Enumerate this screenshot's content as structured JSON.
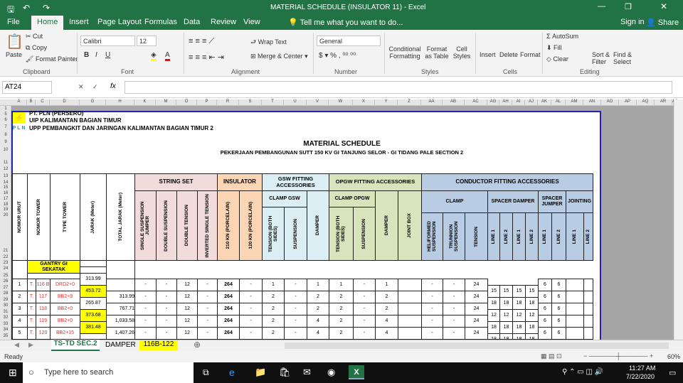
{
  "window": {
    "title": "MATERIAL SCHEDULE (INSULATOR 11)  -  Excel",
    "sign_in": "Sign in",
    "share": "Share"
  },
  "ribbon_tabs": [
    "File",
    "Home",
    "Insert",
    "Page Layout",
    "Formulas",
    "Data",
    "Review",
    "View"
  ],
  "tell_me": "Tell me what you want to do...",
  "clipboard": {
    "paste": "Paste",
    "cut": "Cut",
    "copy": "Copy",
    "format_painter": "Format Painter",
    "group": "Clipboard"
  },
  "font": {
    "name": "Calibri",
    "size": "12",
    "group": "Font"
  },
  "alignment": {
    "wrap": "Wrap Text",
    "merge": "Merge & Center",
    "group": "Alignment"
  },
  "number": {
    "format": "General",
    "group": "Number"
  },
  "styles": {
    "cond": "Conditional Formatting",
    "table": "Format as Table",
    "cell": "Cell Styles",
    "group": "Styles"
  },
  "cells": {
    "insert": "Insert",
    "delete": "Delete",
    "format": "Format",
    "group": "Cells"
  },
  "editing": {
    "autosum": "AutoSum",
    "fill": "Fill",
    "clear": "Clear",
    "sort": "Sort & Filter",
    "find": "Find & Select",
    "group": "Editing"
  },
  "formula_bar": {
    "name_box": "AT24",
    "fx": "fx",
    "value": ""
  },
  "columns": [
    "A",
    "B",
    "C",
    "D",
    "G",
    "H",
    "K",
    "M",
    "O",
    "P",
    "R",
    "S",
    "T",
    "U",
    "V",
    "W",
    "X",
    "Y",
    "Z",
    "AA",
    "AB",
    "AC",
    "AG",
    "AH",
    "AI",
    "AJ",
    "AK",
    "AL",
    "AM",
    "AN",
    "AO",
    "AP",
    "AQ",
    "AR",
    "AS"
  ],
  "rows": [
    "1",
    "5",
    "6",
    "7",
    "8",
    "9",
    "10",
    "11",
    "12",
    "13",
    "14",
    "15",
    "16",
    "17",
    "18",
    "19",
    "20",
    "21",
    "22",
    "23",
    "24",
    "25",
    "26",
    "27",
    "28",
    "29",
    "30",
    "31",
    "32",
    "33",
    "34",
    "35"
  ],
  "company": {
    "logo_text": "PLN",
    "line1": "PT. PLN (PERSERO)",
    "line2": "UIP KALIMANTAN BAGIAN TIMUR",
    "line3": "UPP PEMBANGKIT DAN JARINGAN KALIMANTAN BAGIAN TIMUR 2"
  },
  "doc": {
    "title": "MATERIAL  SCHEDULE",
    "subtitle": "PEKERJAAN PEMBANGUNAN SUTT 150 KV GI TANJUNG SELOR - GI TIDANG PALE SECTION 2"
  },
  "headers": {
    "nomor_urut": "NOMOR URUT",
    "nomor_tower": "NOMOR TOWER",
    "type_tower": "TYPE  TOWER",
    "jarak": "JARAK (Meter)",
    "total_jarak": "TOTAL JARAK (Meter)",
    "string_set": "STRING SET",
    "ssj": "SINGLE SUSPENSION JUMPER",
    "ds": "DOUBLE SUSPENSION",
    "dt": "DOUBLE TENSION",
    "ist": "INVERTED SINGLE TENSION",
    "insulator": "INSULATOR",
    "i210": "210 KN (PORCELAIN)",
    "i120": "120 KN (PORCELAIN)",
    "gsw": "GSW FITTING ACCESSORIES",
    "clamp_gsw": "CLAMP GSW",
    "tension_both": "TENSION (BOTH SIDES)",
    "suspension": "SUSPENSION",
    "damper": "DAMPER",
    "opgw": "OPGW FITTING ACCESSORIES",
    "clamp_opgw": "CLAMP OPGW",
    "joint_box": "JOINT BOX",
    "conductor": "CONDUCTOR FITTING ACCESSORIES",
    "clamp": "CLAMP",
    "heli": "HELIFORMED SUSPENSION",
    "trunnion": "TRUNNION SUSPENSION",
    "tension": "TENSION",
    "spacer_damper": "SPACER DAMPER",
    "spacer_jumper": "SPACER JUMPER",
    "jointing": "JOINTING",
    "line1": "LINE 1",
    "line2": "LINE 2"
  },
  "gantry": "GANTRY GI SEKATAK",
  "data_rows": [
    {
      "no": "1",
      "t": "T.",
      "tower": "116 B",
      "type": "DRD2+0",
      "total": "",
      "vals": [
        "-",
        "-",
        "12",
        "-",
        "264",
        "-",
        "1",
        "-",
        "1",
        "1",
        "-",
        "1",
        "",
        "-",
        "-",
        "24"
      ],
      "jumper": [
        "6",
        "6"
      ]
    },
    {
      "no": "2",
      "t": "T.",
      "tower": "117",
      "type": "BB2+9",
      "total": "313.99",
      "vals": [
        "-",
        "-",
        "12",
        "-",
        "264",
        "-",
        "2",
        "-",
        "2",
        "2",
        "-",
        "2",
        "",
        "-",
        "-",
        "24"
      ],
      "jumper": [
        "6",
        "6"
      ]
    },
    {
      "no": "3",
      "t": "T.",
      "tower": "118",
      "type": "BB2+0",
      "total": "767.71",
      "vals": [
        "-",
        "-",
        "12",
        "-",
        "264",
        "-",
        "2",
        "-",
        "2",
        "2",
        "-",
        "2",
        "",
        "-",
        "-",
        "24"
      ],
      "jumper": [
        "6",
        "6"
      ]
    },
    {
      "no": "4",
      "t": "T.",
      "tower": "119",
      "type": "BB2+0",
      "total": "1,033.58",
      "vals": [
        "-",
        "-",
        "12",
        "-",
        "264",
        "-",
        "2",
        "-",
        "4",
        "2",
        "-",
        "4",
        "",
        "-",
        "-",
        "24"
      ],
      "jumper": [
        "6",
        "6"
      ]
    },
    {
      "no": "5",
      "t": "T.",
      "tower": "120",
      "type": "BB2+15",
      "total": "1,407.26",
      "vals": [
        "-",
        "-",
        "12",
        "-",
        "264",
        "-",
        "2",
        "-",
        "4",
        "2",
        "-",
        "4",
        "",
        "-",
        "-",
        "24"
      ],
      "jumper": [
        "6",
        "6"
      ]
    }
  ],
  "jarak_values": [
    {
      "v": "313.99",
      "highlight": false
    },
    {
      "v": "453.72",
      "highlight": true
    },
    {
      "v": "265.87",
      "highlight": false
    },
    {
      "v": "373.68",
      "highlight": true
    },
    {
      "v": "381.48",
      "highlight": true
    }
  ],
  "spacer_values": [
    [
      "15",
      "15",
      "15",
      "15"
    ],
    [
      "18",
      "18",
      "18",
      "18"
    ],
    [
      "12",
      "12",
      "12",
      "12"
    ],
    [
      "18",
      "18",
      "18",
      "18"
    ],
    [
      "18",
      "18",
      "18",
      "18"
    ]
  ],
  "sheet_tabs": [
    {
      "label": "TS-TD SEC.2",
      "active": true
    },
    {
      "label": "DAMPER",
      "active": false
    },
    {
      "label": "116B-122",
      "active": false,
      "color": "#ffff00"
    }
  ],
  "status": {
    "ready": "Ready",
    "zoom": "60%"
  },
  "taskbar": {
    "search": "Type here to search",
    "time": "11:27 AM",
    "date": "7/22/2020"
  },
  "colors": {
    "excel_green": "#217346",
    "string_set": "#f2dcdb",
    "insulator": "#fcd5b4",
    "gsw": "#daeef3",
    "opgw": "#d8e4bc",
    "conductor": "#b8cce4",
    "yellow": "#ffff00"
  }
}
